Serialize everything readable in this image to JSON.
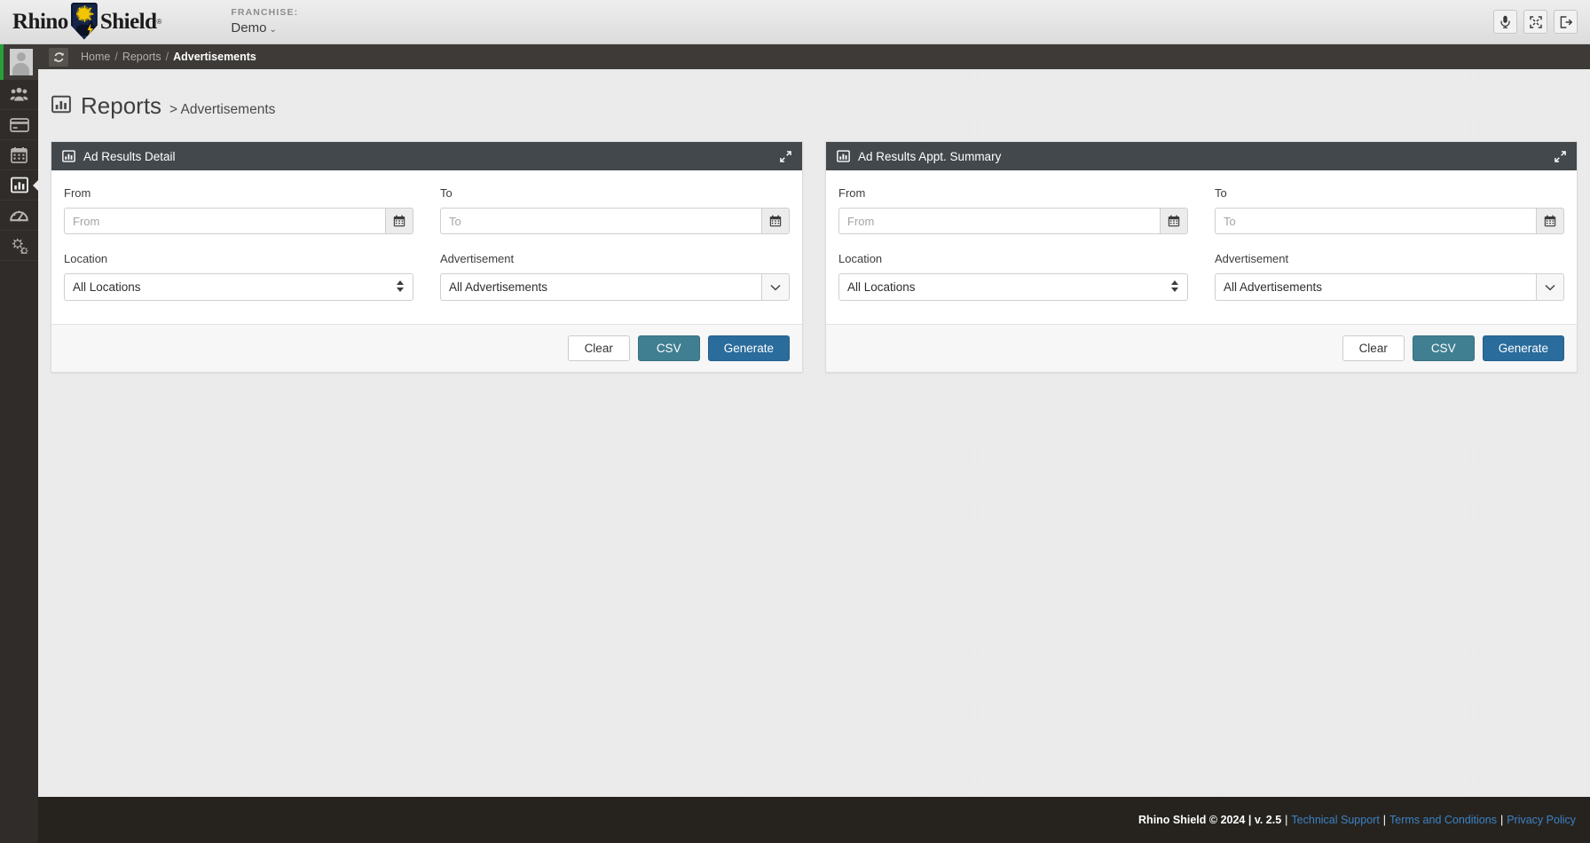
{
  "brand": {
    "logo_left": "Rhino",
    "logo_right": "Shield",
    "trademark": "®"
  },
  "topbar": {
    "franchise_label": "FRANCHISE:",
    "franchise_value": "Demo",
    "franchise_caret": "⌄",
    "actions": [
      {
        "name": "microphone-icon",
        "title": "Voice"
      },
      {
        "name": "fullscreen-icon",
        "title": "Fullscreen"
      },
      {
        "name": "logout-icon",
        "title": "Log out"
      }
    ]
  },
  "breadcrumb": {
    "refresh_title": "Refresh",
    "items": [
      {
        "label": "Home",
        "active": false
      },
      {
        "label": "Reports",
        "active": false
      },
      {
        "label": "Advertisements",
        "active": true
      }
    ],
    "separator": "/"
  },
  "sidebar": {
    "avatar_name": "user-avatar",
    "items": [
      {
        "name": "sidebar-item-customers",
        "icon": "users-icon",
        "active": false
      },
      {
        "name": "sidebar-item-payments",
        "icon": "credit-card-icon",
        "active": false
      },
      {
        "name": "sidebar-item-calendar",
        "icon": "calendar-icon",
        "active": false
      },
      {
        "name": "sidebar-item-reports",
        "icon": "bar-chart-icon",
        "active": true
      },
      {
        "name": "sidebar-item-dashboard",
        "icon": "gauge-icon",
        "active": false
      },
      {
        "name": "sidebar-item-settings",
        "icon": "gears-icon",
        "active": false
      }
    ]
  },
  "page": {
    "title": "Reports",
    "subtitle": "> Advertisements",
    "icon": "bar-chart-icon"
  },
  "panels": [
    {
      "id": "ad-results-detail",
      "title": "Ad Results Detail",
      "icon": "bar-chart-icon",
      "expand_title": "Expand",
      "fields": {
        "from_label": "From",
        "from_placeholder": "From",
        "from_value": "",
        "to_label": "To",
        "to_placeholder": "To",
        "to_value": "",
        "location_label": "Location",
        "location_value": "All Locations",
        "advertisement_label": "Advertisement",
        "advertisement_value": "All Advertisements"
      },
      "buttons": {
        "clear": "Clear",
        "csv": "CSV",
        "generate": "Generate"
      }
    },
    {
      "id": "ad-results-appt-summary",
      "title": "Ad Results Appt. Summary",
      "icon": "bar-chart-icon",
      "expand_title": "Expand",
      "fields": {
        "from_label": "From",
        "from_placeholder": "From",
        "from_value": "",
        "to_label": "To",
        "to_placeholder": "To",
        "to_value": "",
        "location_label": "Location",
        "location_value": "All Locations",
        "advertisement_label": "Advertisement",
        "advertisement_value": "All Advertisements"
      },
      "buttons": {
        "clear": "Clear",
        "csv": "CSV",
        "generate": "Generate"
      }
    }
  ],
  "footer": {
    "copyright": "Rhino Shield © 2024 | v. 2.5",
    "sep": "|",
    "links": [
      {
        "label": "Technical Support"
      },
      {
        "label": "Terms and Conditions"
      },
      {
        "label": "Privacy Policy"
      }
    ]
  },
  "colors": {
    "accent_blue": "#2a6c9c",
    "accent_teal": "#407f91",
    "panel_header": "#43484c",
    "topbar_bg": "#e4e4e4",
    "crumbbar_bg": "#3d3a37",
    "sidebar_bg": "#2f2c29",
    "footer_bg": "#26231f",
    "link_blue": "#3c82c4",
    "active_green": "#27a03a"
  }
}
